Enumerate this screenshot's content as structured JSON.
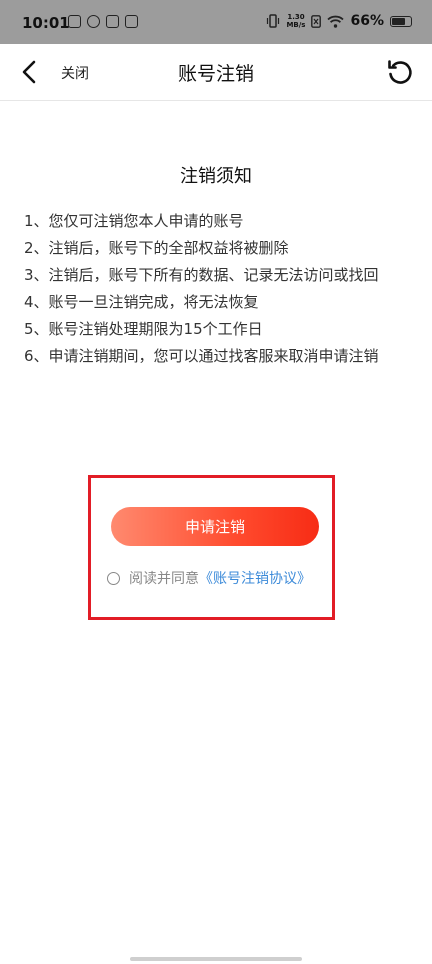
{
  "status_bar": {
    "time": "10:01",
    "speed_top": "1.30",
    "speed_bottom": "MB/s",
    "battery": "66%"
  },
  "nav": {
    "close_label": "关闭",
    "title": "账号注销"
  },
  "notice": {
    "title": "注销须知",
    "items": [
      "1、您仅可注销您本人申请的账号",
      "2、注销后，账号下的全部权益将被删除",
      "3、注销后，账号下所有的数据、记录无法访问或找回",
      "4、账号一旦注销完成，将无法恢复",
      "5、账号注销处理期限为15个工作日",
      "6、申请注销期间，您可以通过找客服来取消申请注销"
    ]
  },
  "action": {
    "apply_label": "申请注销",
    "agree_text": "阅读并同意",
    "agreement_link": "《账号注销协议》"
  },
  "colors": {
    "accent_start": "#ff8a6f",
    "accent_end": "#f72c15",
    "link": "#3d8bd9",
    "highlight_border": "#e21d26"
  }
}
